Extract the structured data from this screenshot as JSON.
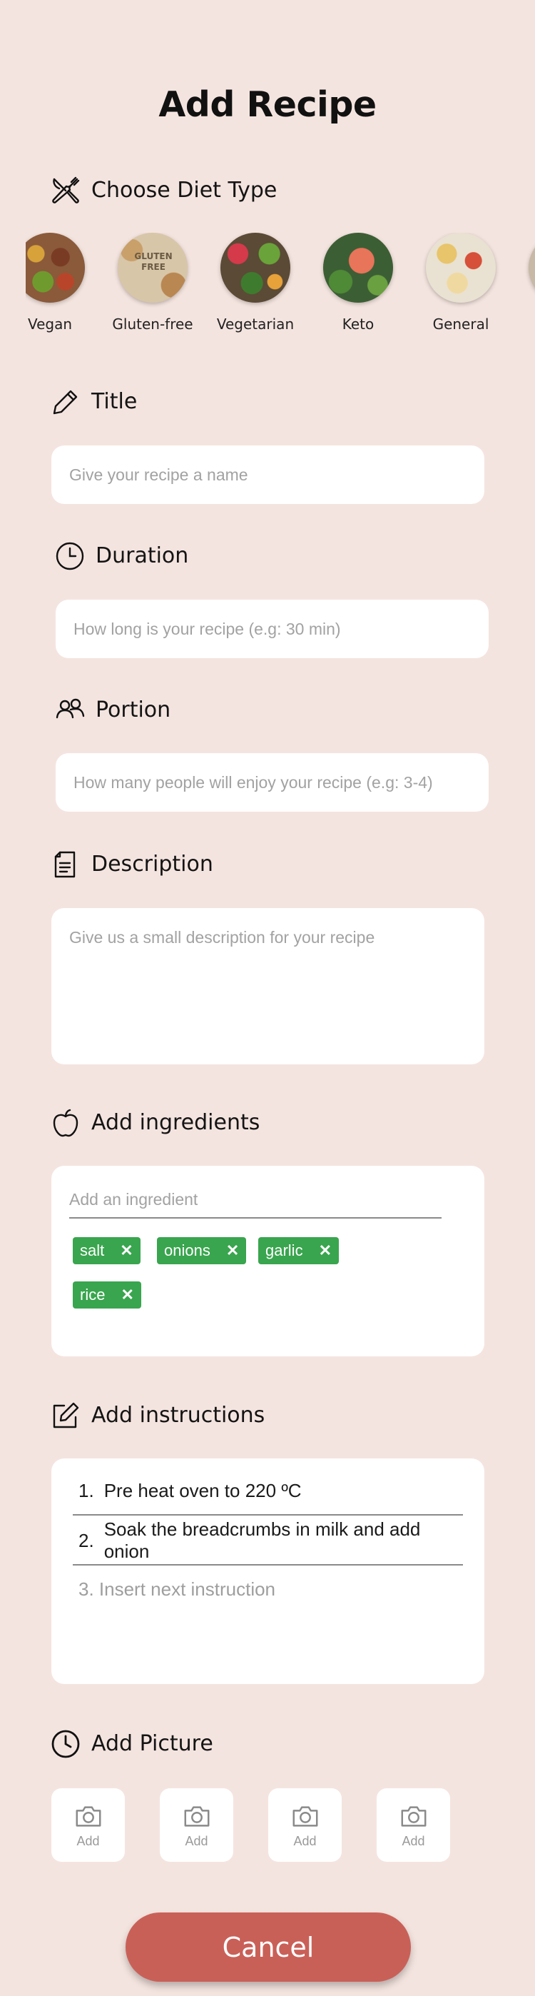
{
  "page": {
    "title": "Add Recipe"
  },
  "colors": {
    "background": "#f4e4df",
    "chip": "#39a54e",
    "cancel": "#c96058",
    "card": "#ffffff"
  },
  "diet": {
    "heading": "Choose Diet Type",
    "icon": "fork-knife-icon",
    "items": [
      {
        "label": "Vegan",
        "image": "vegan-food-photo"
      },
      {
        "label": "Gluten-free",
        "image": "gluten-free-photo",
        "badge": "GLUTEN FREE"
      },
      {
        "label": "Vegetarian",
        "image": "vegetarian-food-photo"
      },
      {
        "label": "Keto",
        "image": "keto-food-photo"
      },
      {
        "label": "General",
        "image": "general-food-photo"
      }
    ]
  },
  "title_section": {
    "heading": "Title",
    "icon": "pencil-icon",
    "placeholder": "Give your recipe a name"
  },
  "duration": {
    "heading": "Duration",
    "icon": "clock-icon",
    "placeholder": "How long is your recipe (e.g: 30 min)"
  },
  "portion": {
    "heading": "Portion",
    "icon": "people-icon",
    "placeholder": "How many people will enjoy your recipe (e.g: 3-4)"
  },
  "description": {
    "heading": "Description",
    "icon": "document-icon",
    "placeholder": "Give us a small description for your recipe"
  },
  "ingredients": {
    "heading": "Add ingredients",
    "icon": "apple-icon",
    "placeholder": "Add an ingredient",
    "chips": [
      "salt",
      "onions",
      "garlic",
      "rice"
    ],
    "remove_glyph": "✕"
  },
  "instructions": {
    "heading": "Add instructions",
    "icon": "edit-icon",
    "steps": [
      {
        "num": "1.",
        "text": "Pre heat oven to 220 ºC"
      },
      {
        "num": "2.",
        "text": "Soak the breadcrumbs in milk and add onion"
      }
    ],
    "placeholder": "3. Insert next instruction"
  },
  "picture": {
    "heading": "Add Picture",
    "icon": "clock-icon",
    "tiles": [
      {
        "label": "Add",
        "icon": "camera-icon"
      },
      {
        "label": "Add",
        "icon": "camera-icon"
      },
      {
        "label": "Add",
        "icon": "camera-icon"
      },
      {
        "label": "Add",
        "icon": "camera-icon"
      }
    ]
  },
  "actions": {
    "cancel_label": "Cancel"
  }
}
